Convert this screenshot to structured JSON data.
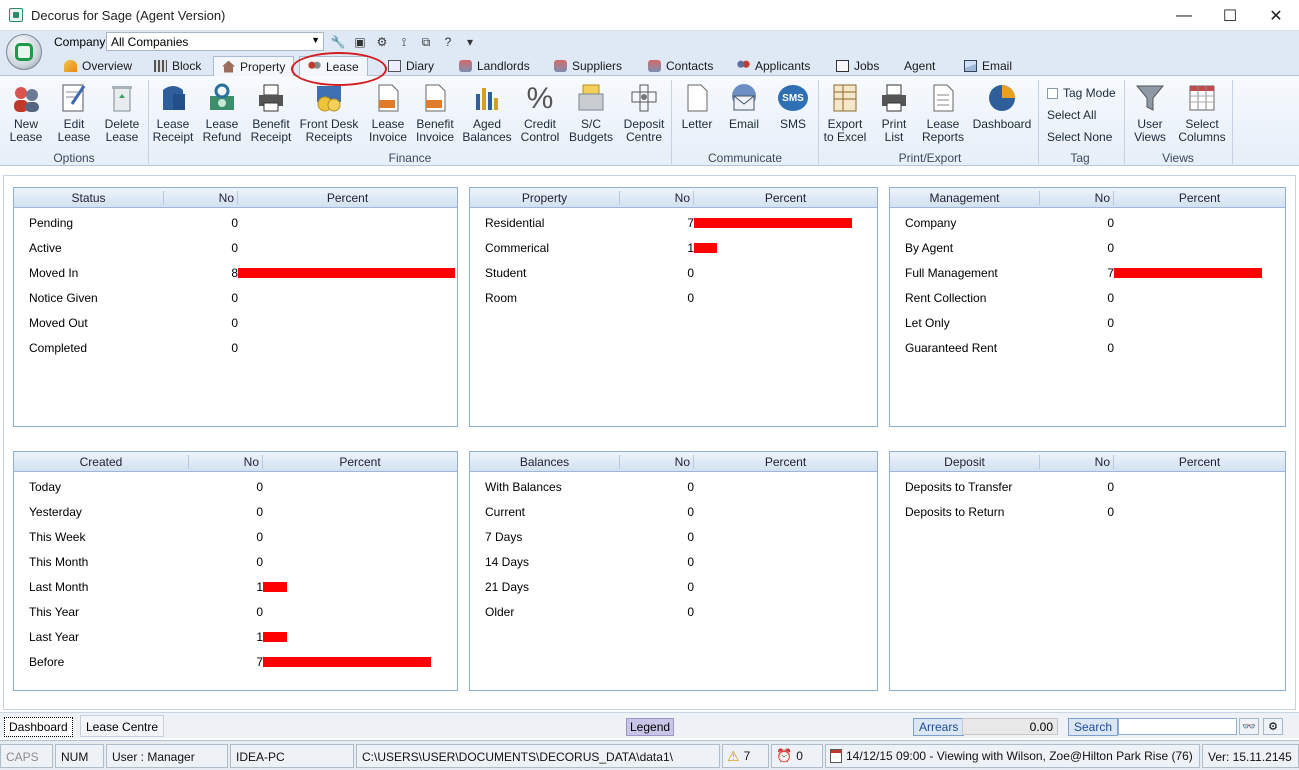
{
  "window": {
    "title": "Decorus for Sage (Agent Version)",
    "min": "—",
    "max": "☐",
    "close": "✕"
  },
  "toolbar": {
    "company_label": "Company",
    "company_value": "All Companies"
  },
  "tabs": [
    "Overview",
    "Block",
    "Property",
    "Lease",
    "Diary",
    "Landlords",
    "Suppliers",
    "Contacts",
    "Applicants",
    "Jobs",
    "Agent",
    "Email"
  ],
  "ribbon": {
    "buttons": [
      {
        "label1": "New",
        "label2": "Lease"
      },
      {
        "label1": "Edit",
        "label2": "Lease"
      },
      {
        "label1": "Delete",
        "label2": "Lease"
      },
      {
        "label1": "Lease",
        "label2": "Receipt"
      },
      {
        "label1": "Lease",
        "label2": "Refund"
      },
      {
        "label1": "Benefit",
        "label2": "Receipt"
      },
      {
        "label1": "Front Desk",
        "label2": "Receipts"
      },
      {
        "label1": "Lease",
        "label2": "Invoice"
      },
      {
        "label1": "Benefit",
        "label2": "Invoice"
      },
      {
        "label1": "Aged",
        "label2": "Balances"
      },
      {
        "label1": "Credit",
        "label2": "Control"
      },
      {
        "label1": "S/C",
        "label2": "Budgets"
      },
      {
        "label1": "Deposit",
        "label2": "Centre"
      },
      {
        "label1": "Letter",
        "label2": ""
      },
      {
        "label1": "Email",
        "label2": ""
      },
      {
        "label1": "SMS",
        "label2": ""
      },
      {
        "label1": "Export",
        "label2": "to Excel"
      },
      {
        "label1": "Print",
        "label2": "List"
      },
      {
        "label1": "Lease",
        "label2": "Reports"
      },
      {
        "label1": "Dashboard",
        "label2": ""
      },
      {
        "label1": "User",
        "label2": "Views"
      },
      {
        "label1": "Select",
        "label2": "Columns"
      }
    ],
    "groups": [
      "Options",
      "Finance",
      "Communicate",
      "Print/Export",
      "Tag",
      "Views"
    ],
    "tag_mode": "Tag Mode",
    "select_all": "Select All",
    "select_none": "Select None",
    "sms_text": "SMS"
  },
  "panels": [
    {
      "title": "Status",
      "no": "No",
      "percent": "Percent",
      "rows": [
        {
          "label": "Pending",
          "value": "0",
          "frac": 0
        },
        {
          "label": "Active",
          "value": "0",
          "frac": 0
        },
        {
          "label": "Moved In",
          "value": "8",
          "frac": 1.0
        },
        {
          "label": "Notice Given",
          "value": "0",
          "frac": 0
        },
        {
          "label": "Moved Out",
          "value": "0",
          "frac": 0
        },
        {
          "label": "Completed",
          "value": "0",
          "frac": 0
        }
      ]
    },
    {
      "title": "Property",
      "no": "No",
      "percent": "Percent",
      "rows": [
        {
          "label": "Residential",
          "value": "7",
          "frac": 0.875
        },
        {
          "label": "Commerical",
          "value": "1",
          "frac": 0.125
        },
        {
          "label": "Student",
          "value": "0",
          "frac": 0
        },
        {
          "label": "Room",
          "value": "0",
          "frac": 0
        }
      ]
    },
    {
      "title": "Management",
      "no": "No",
      "percent": "Percent",
      "rows": [
        {
          "label": "Company",
          "value": "0",
          "frac": 0
        },
        {
          "label": "By Agent",
          "value": "0",
          "frac": 0
        },
        {
          "label": "Full Management",
          "value": "7",
          "frac": 1.0
        },
        {
          "label": "Rent Collection",
          "value": "0",
          "frac": 0
        },
        {
          "label": "Let Only",
          "value": "0",
          "frac": 0
        },
        {
          "label": "Guaranteed Rent",
          "value": "0",
          "frac": 0
        }
      ]
    },
    {
      "title": "Created",
      "no": "No",
      "percent": "Percent",
      "rows": [
        {
          "label": "Today",
          "value": "0",
          "frac": 0
        },
        {
          "label": "Yesterday",
          "value": "0",
          "frac": 0
        },
        {
          "label": "This Week",
          "value": "0",
          "frac": 0
        },
        {
          "label": "This Month",
          "value": "0",
          "frac": 0
        },
        {
          "label": "Last Month",
          "value": "1",
          "frac": 0.143
        },
        {
          "label": "This Year",
          "value": "0",
          "frac": 0
        },
        {
          "label": "Last Year",
          "value": "1",
          "frac": 0.143
        },
        {
          "label": "Before",
          "value": "7",
          "frac": 1.0
        }
      ]
    },
    {
      "title": "Balances",
      "no": "No",
      "percent": "Percent",
      "rows": [
        {
          "label": "With Balances",
          "value": "0",
          "frac": 0
        },
        {
          "label": "Current",
          "value": "0",
          "frac": 0
        },
        {
          "label": "7 Days",
          "value": "0",
          "frac": 0
        },
        {
          "label": "14 Days",
          "value": "0",
          "frac": 0
        },
        {
          "label": "21 Days",
          "value": "0",
          "frac": 0
        },
        {
          "label": "Older",
          "value": "0",
          "frac": 0
        }
      ]
    },
    {
      "title": "Deposit",
      "no": "No",
      "percent": "Percent",
      "rows": [
        {
          "label": "Deposits to Transfer",
          "value": "0",
          "frac": 0
        },
        {
          "label": "Deposits to Return",
          "value": "0",
          "frac": 0
        }
      ]
    }
  ],
  "bottom": {
    "tab_dashboard": "Dashboard",
    "tab_lease_centre": "Lease Centre",
    "legend": "Legend",
    "arrears_label": "Arrears",
    "arrears_value": "0.00",
    "search_label": "Search",
    "search_value": ""
  },
  "status": {
    "caps": "CAPS",
    "num": "NUM",
    "user": "User : Manager",
    "pc": "IDEA-PC",
    "path": "C:\\USERS\\USER\\DOCUMENTS\\DECORUS_DATA\\data1\\",
    "warnings": "7",
    "alarms": "0",
    "viewing": "14/12/15 09:00 - Viewing with Wilson, Zoe@Hilton Park Rise (76)",
    "version": "Ver: 15.11.2145"
  },
  "colors": {
    "bar": "#ff0000",
    "accent": "#1d4b97",
    "highlight_circle": "#d21e1e"
  }
}
